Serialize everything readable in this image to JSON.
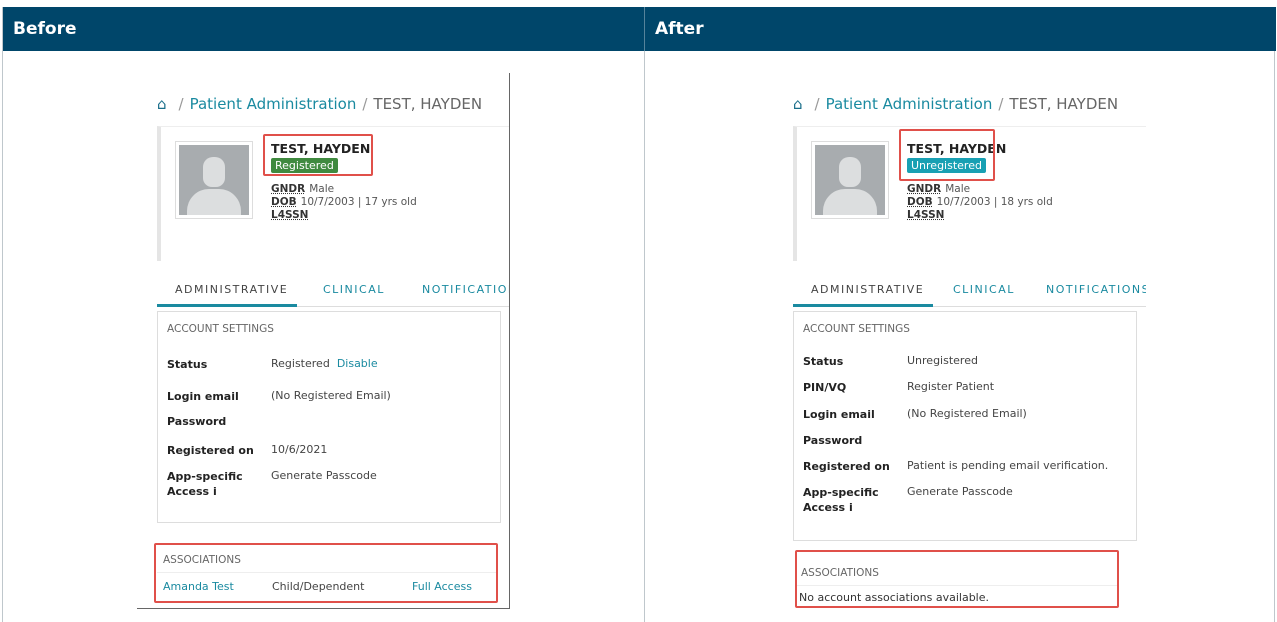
{
  "headers": {
    "before": "Before",
    "after": "After"
  },
  "before": {
    "breadcrumb": {
      "section": "Patient Administration",
      "current": "TEST, HAYDEN"
    },
    "patient": {
      "name": "TEST, HAYDEN",
      "status_badge": "Registered",
      "gender_label": "GNDR",
      "gender_value": "Male",
      "dob_label": "DOB",
      "dob_value": "10/7/2003 | 17 yrs old",
      "l4ssn_label": "L4SSN"
    },
    "tabs": [
      "ADMINISTRATIVE",
      "CLINICAL",
      "NOTIFICATIONS"
    ],
    "account_settings": {
      "title": "ACCOUNT SETTINGS",
      "status_label": "Status",
      "status_value": "Registered",
      "status_action": "Disable",
      "login_label": "Login email",
      "login_value": "(No Registered Email)",
      "password_label": "Password",
      "registered_label": "Registered on",
      "registered_value": "10/6/2021",
      "app_label": "App-specific Access",
      "app_info": "i",
      "app_action": "Generate Passcode"
    },
    "associations": {
      "title": "ASSOCIATIONS",
      "rows": [
        {
          "name": "Amanda Test",
          "relation": "Child/Dependent",
          "access": "Full Access"
        }
      ]
    }
  },
  "after": {
    "breadcrumb": {
      "section": "Patient Administration",
      "current": "TEST, HAYDEN"
    },
    "patient": {
      "name": "TEST, HAYDEN",
      "status_badge": "Unregistered",
      "gender_label": "GNDR",
      "gender_value": "Male",
      "dob_label": "DOB",
      "dob_value": "10/7/2003 | 18 yrs old",
      "l4ssn_label": "L4SSN"
    },
    "tabs": [
      "ADMINISTRATIVE",
      "CLINICAL",
      "NOTIFICATIONS"
    ],
    "account_settings": {
      "title": "ACCOUNT SETTINGS",
      "status_label": "Status",
      "status_value": "Unregistered",
      "pin_label": "PIN/VQ",
      "pin_action": "Register Patient",
      "login_label": "Login email",
      "login_value": "(No Registered Email)",
      "password_label": "Password",
      "registered_label": "Registered on",
      "registered_value": "Patient is pending email verification.",
      "app_label": "App-specific Access",
      "app_info": "i",
      "app_action": "Generate Passcode"
    },
    "associations": {
      "title": "ASSOCIATIONS",
      "empty_text": "No account associations available."
    }
  },
  "colors": {
    "header_bg": "#00466a",
    "link": "#1a8aa0",
    "registered_badge": "#3f8a3f",
    "unregistered_badge": "#18a0b3",
    "highlight": "#e0504a"
  }
}
